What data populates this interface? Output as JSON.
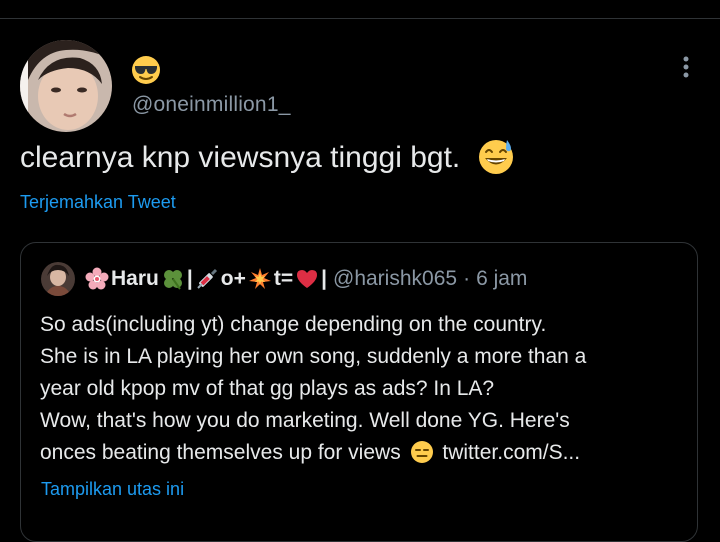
{
  "tweet": {
    "handle": "@oneinmillion1_",
    "name_emoji_icon": "sunglasses-face-icon",
    "text": "clearnya knp viewsnya tinggi bgt.",
    "text_emoji_icon": "grinning-sweat-face-icon",
    "translate_label": "Terjemahkan Tweet",
    "more_icon": "more-vertical-icon"
  },
  "quote": {
    "name_part1": "Haru",
    "name_part2": "|",
    "name_part3": "o+",
    "name_part4": "t=",
    "name_part5": "|",
    "handle": "@harishk065",
    "separator": "·",
    "time": "6 jam",
    "lines": [
      "So ads(including yt) change depending on the country.",
      "She is in LA playing her own song, suddenly a more than a",
      "year old kpop mv of that gg plays as ads? In LA?",
      "Wow, that's how you do marketing. Well done YG. Here's"
    ],
    "last_line_text": "onces beating themselves up for views",
    "last_line_link": "twitter.com/S...",
    "show_thread_label": "Tampilkan utas ini",
    "icons": [
      "blossom-icon",
      "four-leaf-clover-icon",
      "syringe-icon",
      "collision-icon",
      "heart-icon",
      "expressionless-face-icon"
    ]
  },
  "colors": {
    "background": "#000000",
    "text": "#e7e9ea",
    "muted": "#8b98a5",
    "link": "#1d9bf0",
    "border": "#2f3336"
  }
}
